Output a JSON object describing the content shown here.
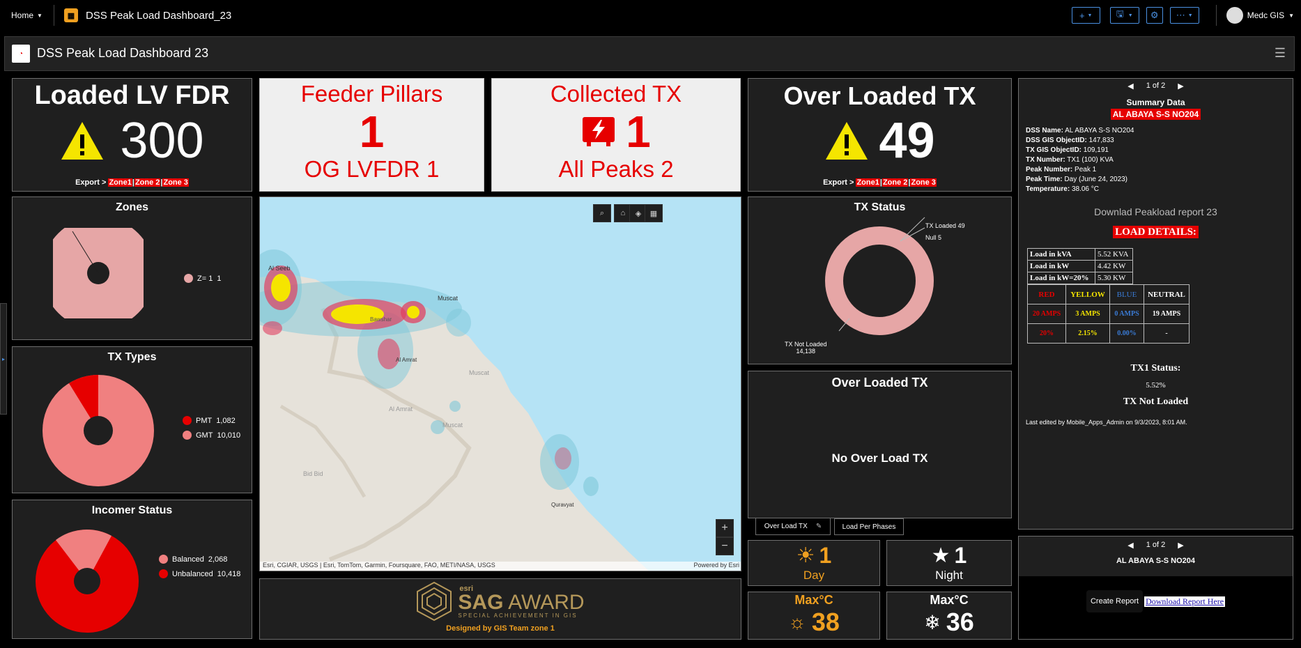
{
  "topbar": {
    "home_label": "Home",
    "app_title": "DSS Peak Load Dashboard_23",
    "add_label": "+",
    "user_name": "Medc GIS"
  },
  "header": {
    "title": "DSS Peak Load Dashboard 23"
  },
  "indicators": {
    "loaded_lv_fdr": {
      "title": "Loaded LV FDR",
      "value": "300"
    },
    "feeder_pillars": {
      "title": "Feeder Pillars",
      "value": "1",
      "bottom_label": "OG LVFDR",
      "bottom_value": "1"
    },
    "collected_tx": {
      "title": "Collected TX",
      "value": "1",
      "bottom_label": "All Peaks",
      "bottom_value": "2"
    },
    "over_loaded_tx": {
      "title": "Over Loaded TX",
      "value": "49"
    }
  },
  "export": {
    "prefix": "Export >",
    "zone1": "Zone1",
    "zone2": "Zone 2",
    "zone3": "Zone 3",
    "sep": "|"
  },
  "colors": {
    "red": "#e60000",
    "pink": "#f08080",
    "light_pink": "#e6a6a6",
    "orange": "#f0a020",
    "yellow": "#f5e500"
  },
  "zones": {
    "title": "Zones",
    "legend": [
      {
        "label": "Z= 1",
        "value": "1"
      }
    ]
  },
  "tx_types": {
    "title": "TX Types",
    "legend": [
      {
        "label": "PMT",
        "value": "1,082"
      },
      {
        "label": "GMT",
        "value": "10,010"
      }
    ]
  },
  "incomer": {
    "title": "Incomer Status",
    "legend": [
      {
        "label": "Balanced",
        "value": "2,068"
      },
      {
        "label": "Unbalanced",
        "value": "10,418"
      }
    ]
  },
  "tx_status": {
    "title": "TX Status",
    "labels": [
      {
        "label": "TX Loaded",
        "value": "49"
      },
      {
        "label": "Null",
        "value": "5"
      },
      {
        "label": "TX Not Loaded",
        "value": "14,138"
      }
    ]
  },
  "over_loaded_panel": {
    "title": "Over Loaded TX",
    "message": "No Over Load TX"
  },
  "tabs": [
    {
      "label": "Over Load TX"
    },
    {
      "label": "Load Per Phases"
    }
  ],
  "map": {
    "place_labels": [
      "Al Seeb",
      "Muscat",
      "Bawshar",
      "Al Amrat",
      "Muscat",
      "Al Amrat",
      "Muscat",
      "Quravyat",
      "Bid Bid"
    ],
    "attribution": "Esri, CGIAR, USGS | Esri, TomTom, Garmin, Foursquare, FAO, METI/NASA, USGS",
    "powered": "Powered by Esri",
    "zoom_in": "+",
    "zoom_out": "−"
  },
  "award": {
    "esri": "esri",
    "sag": "SAG",
    "award": "AWARD",
    "subtitle": "SPECIAL ACHIEVEMENT IN GIS",
    "credit": "Designed by GIS Team zone 1"
  },
  "weather": {
    "day_value": "1",
    "day_label": "Day",
    "night_value": "1",
    "night_label": "Night",
    "max_label": "Max°C",
    "max_day": "38",
    "max_night": "36"
  },
  "summary": {
    "pager": "1 of 2",
    "title": "Summary Data",
    "dss_highlight": "AL ABAYA S-S NO204",
    "fields": [
      {
        "label": "DSS Name:",
        "value": "AL ABAYA S-S NO204"
      },
      {
        "label": "DSS GIS ObjectID:",
        "value": "147,833"
      },
      {
        "label": "TX GIS ObjectID:",
        "value": "109,191"
      },
      {
        "label": "TX Number:",
        "value": "TX1 (100) KVA"
      },
      {
        "label": "Peak Number:",
        "value": "Peak 1"
      },
      {
        "label": "Peak Time:",
        "value": "Day (June 24, 2023)"
      },
      {
        "label": "Temperature:",
        "value": "38.06 °C"
      }
    ],
    "download_title": "Downlad Peakload report 23",
    "load_details": "LOAD DETAILS:",
    "load_rows": [
      {
        "label": "Load in kVA",
        "value": "5.52 KVA"
      },
      {
        "label": "Load in kW",
        "value": "4.42 KW"
      },
      {
        "label": "Load in kW=20%",
        "value": "5.30 KW"
      }
    ],
    "phase_headers": [
      "RED",
      "YELLOW",
      "BLUE",
      "NEUTRAL"
    ],
    "phase_amps": [
      "20 AMPS",
      "3 AMPS",
      "0 AMPS",
      "19 AMPS"
    ],
    "phase_pct": [
      "20%",
      "2.15%",
      "0.00%",
      "-"
    ],
    "tx_status_label": "TX1 Status:",
    "tx_status_pct": "5.52%",
    "tx_status_text": "TX Not Loaded",
    "last_edited": "Last edited by Mobile_Apps_Admin on 9/3/2023, 8:01 AM."
  },
  "report": {
    "pager": "1 of 2",
    "name": "AL ABAYA S-S NO204",
    "create": "Create Report",
    "download": "Download Report Here"
  }
}
